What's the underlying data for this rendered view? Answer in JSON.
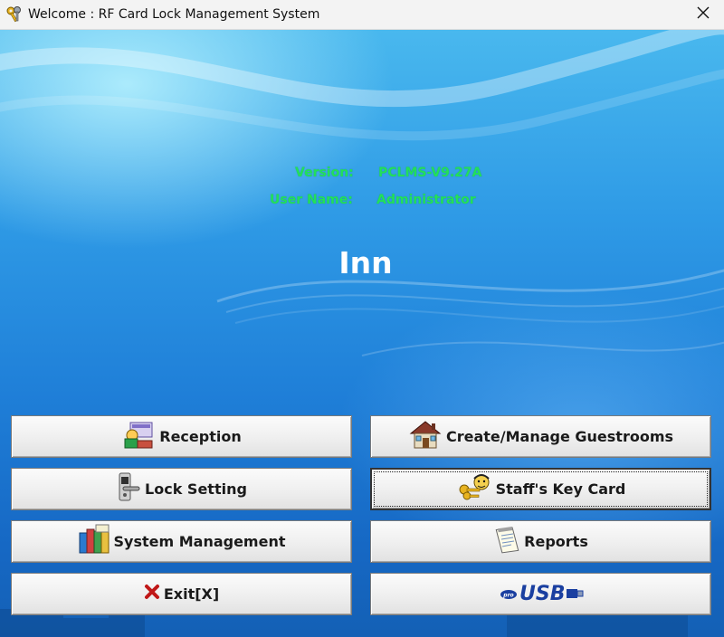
{
  "window": {
    "title": "Welcome :  RF Card Lock Management System",
    "app_icon": "keys-icon",
    "close_icon": "close-icon"
  },
  "info": {
    "version_label": "Version:",
    "version_value": "PCLMS-V9.27A",
    "user_label": "User Name:",
    "user_value": "Administrator",
    "color": "#22e05a"
  },
  "property_name": "Inn",
  "buttons": {
    "reception": {
      "label": "Reception",
      "icon": "reception-desk-icon"
    },
    "guestrooms": {
      "label": "Create/Manage Guestrooms",
      "icon": "house-icon"
    },
    "lock_setting": {
      "label": "Lock Setting",
      "icon": "door-lock-icon"
    },
    "staff_key_card": {
      "label": "Staff's Key Card",
      "icon": "staff-keys-icon"
    },
    "system_management": {
      "label": "System Management",
      "icon": "books-icon"
    },
    "reports": {
      "label": "Reports",
      "icon": "notepad-icon"
    },
    "exit": {
      "label": "Exit[X]",
      "icon": "red-x-icon"
    },
    "usb": {
      "label": "USB",
      "icon": "usb-logo-icon"
    }
  }
}
